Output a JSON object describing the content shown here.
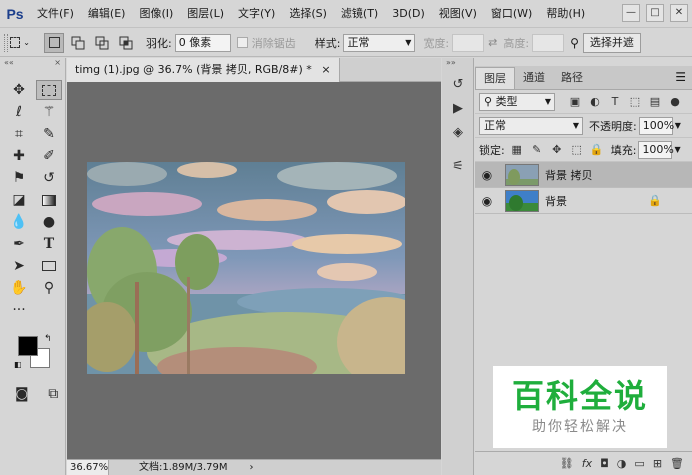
{
  "app": {
    "logo": "Ps"
  },
  "menu": [
    "文件(F)",
    "编辑(E)",
    "图像(I)",
    "图层(L)",
    "文字(Y)",
    "选择(S)",
    "滤镜(T)",
    "3D(D)",
    "视图(V)",
    "窗口(W)",
    "帮助(H)"
  ],
  "window_controls": {
    "minimize": "—",
    "restore": "□",
    "close": "✕"
  },
  "options": {
    "feather_label": "羽化:",
    "feather_value": "0 像素",
    "antialias_label": "消除锯齿",
    "style_label": "样式:",
    "style_value": "正常",
    "width_label": "宽度:",
    "height_label": "高度:",
    "select_mask_button": "选择并遮"
  },
  "document": {
    "tab_title": "timg (1).jpg @ 36.7% (背景 拷贝, RGB/8#) *",
    "tab_close": "×",
    "zoom": "36.67%",
    "info": "文档:1.89M/3.79M",
    "status_arrow": "›"
  },
  "layers_panel": {
    "tabs": [
      "图层",
      "通道",
      "路径"
    ],
    "filter_kind": "类型",
    "blend_mode": "正常",
    "opacity_label": "不透明度:",
    "opacity_value": "100%",
    "lock_label": "锁定:",
    "fill_label": "填充:",
    "fill_value": "100%",
    "layers": [
      {
        "name": "背景 拷贝",
        "selected": true,
        "locked": false
      },
      {
        "name": "背景",
        "selected": false,
        "locked": true
      }
    ],
    "bottom_icons": [
      "link-icon",
      "fx-icon",
      "mask-icon",
      "adjustment-icon",
      "group-icon",
      "new-layer-icon",
      "trash-icon"
    ]
  },
  "watermark": {
    "title": "百科全说",
    "subtitle": "助你轻松解决"
  },
  "colors": {
    "menu_bg": "#d6d6d6",
    "canvas_bg": "#6b6b6b",
    "watermark_green": "#1fae3c"
  }
}
